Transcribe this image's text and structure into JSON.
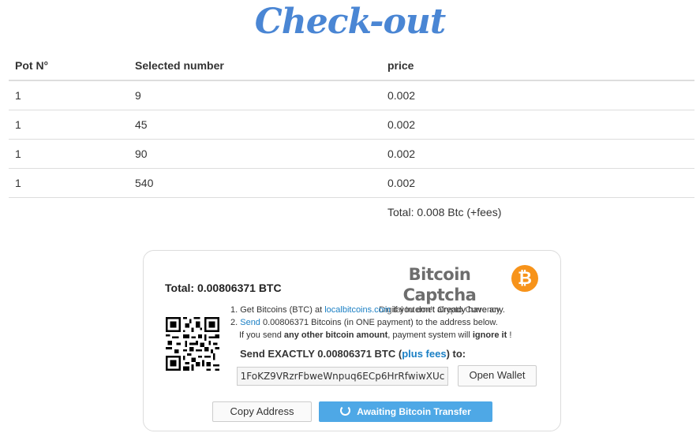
{
  "page": {
    "title": "Check-out"
  },
  "table": {
    "headers": [
      "Pot N°",
      "Selected number",
      "price"
    ],
    "rows": [
      [
        "1",
        "9",
        "0.002"
      ],
      [
        "1",
        "45",
        "0.002"
      ],
      [
        "1",
        "90",
        "0.002"
      ],
      [
        "1",
        "540",
        "0.002"
      ]
    ],
    "total": "Total: 0.008 Btc (+fees)"
  },
  "payment": {
    "total_label": "Total:",
    "total_amount": "0.00806371 BTC",
    "brand_name": "Bitcoin Captcha",
    "brand_sub": "Digital Internet Crypto Currency",
    "logo_glyph": "₿",
    "logo_color": "#f7931a",
    "step1_prefix": "1. Get Bitcoins (BTC) at ",
    "step1_link": "localbitcoins.com",
    "step1_suffix": " if you don't already have any.",
    "step2_prefix": "2. ",
    "step2_link": "Send",
    "step2_suffix": " 0.00806371 Bitcoins (in ONE payment) to the address below.",
    "step3_prefix": "If you send ",
    "step3_bold1": "any other bitcoin amount",
    "step3_middle": ", payment system will ",
    "step3_bold2": "ignore it",
    "step3_suffix": " !",
    "send_prefix": "Send EXACTLY 0.00806371 BTC (",
    "send_link": "plus fees",
    "send_suffix": ") to:",
    "address": "1FoKZ9VRzrFbweWnpuq6ECp6HrRfwiwXUc",
    "open_wallet": "Open Wallet",
    "copy_address": "Copy Address",
    "awaiting": "Awaiting Bitcoin Transfer",
    "accent_color": "#4ea8e6",
    "link_color": "#1a7fc4"
  }
}
